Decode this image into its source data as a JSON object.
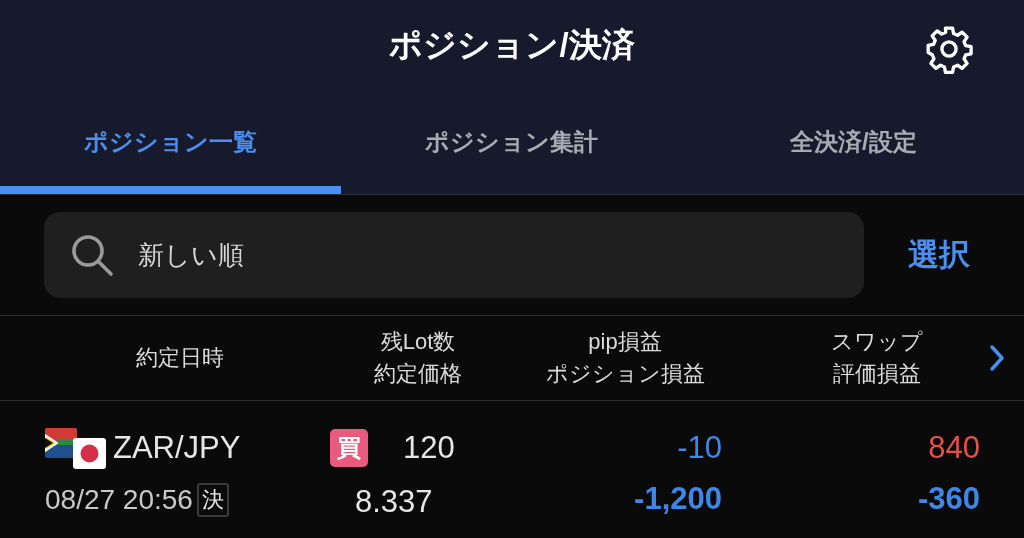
{
  "header": {
    "title": "ポジション/決済"
  },
  "tabs": [
    {
      "label": "ポジション一覧",
      "selected": true
    },
    {
      "label": "ポジション集計",
      "selected": false
    },
    {
      "label": "全決済/設定",
      "selected": false
    }
  ],
  "search": {
    "placeholder": "新しい順"
  },
  "select_button": "選択",
  "columns": [
    {
      "lines": [
        "約定日時"
      ]
    },
    {
      "lines": [
        "残Lot数",
        "約定価格"
      ]
    },
    {
      "lines": [
        "pip損益",
        "ポジション損益"
      ]
    },
    {
      "lines": [
        "スワップ",
        "評価損益"
      ]
    }
  ],
  "positions": [
    {
      "pair": "ZAR/JPY",
      "side": "買",
      "lots": "120",
      "datetime": "08/27 20:56",
      "settle_badge": "決",
      "price": "8.337",
      "pip_pl": {
        "text": "-10",
        "color": "#3f86e6"
      },
      "swap": {
        "text": "840",
        "color": "#e2514a"
      },
      "position_pl": {
        "text": "-1,200",
        "color": "#3f86e6"
      },
      "valuation_pl": {
        "text": "-360",
        "color": "#3f86e6"
      }
    }
  ]
}
